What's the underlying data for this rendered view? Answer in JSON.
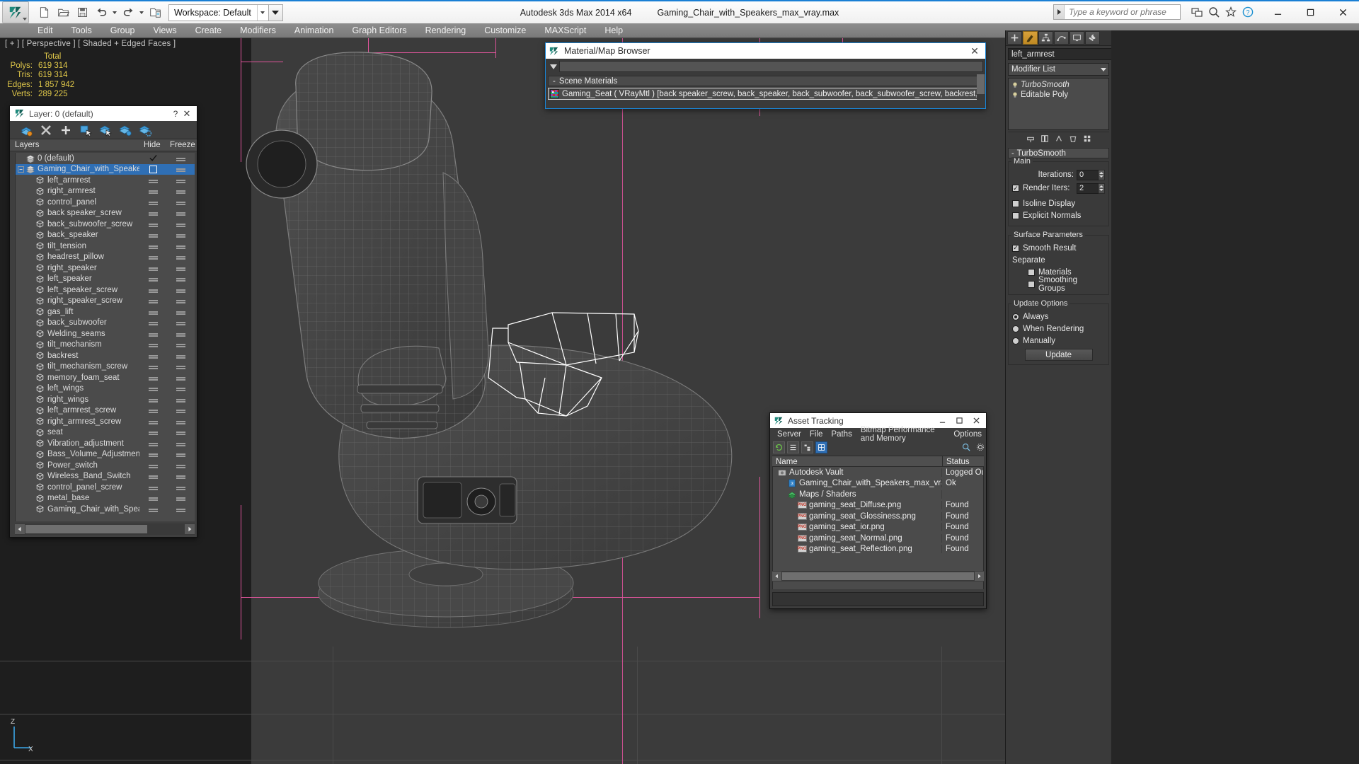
{
  "titlebar": {
    "workspace_label": "Workspace: Default",
    "app_title": "Autodesk 3ds Max  2014 x64",
    "file_title": "Gaming_Chair_with_Speakers_max_vray.max",
    "search_placeholder": "Type a keyword or phrase",
    "quick_access": [
      "new-file-icon",
      "open-file-icon",
      "save-file-icon",
      "undo-icon",
      "redo-icon",
      "set-project-folder-icon"
    ],
    "window_buttons": [
      "minimize",
      "maximize",
      "close"
    ]
  },
  "menubar": {
    "items": [
      "Edit",
      "Tools",
      "Group",
      "Views",
      "Create",
      "Modifiers",
      "Animation",
      "Graph Editors",
      "Rendering",
      "Customize",
      "MAXScript",
      "Help"
    ]
  },
  "viewport": {
    "label": "[ + ] [ Perspective ] [ Shaded + Edged Faces ]",
    "stats_header": "Total",
    "stats": [
      {
        "label": "Polys:",
        "value": "619 314"
      },
      {
        "label": "Tris:",
        "value": "619 314"
      },
      {
        "label": "Edges:",
        "value": "1 857 942"
      },
      {
        "label": "Verts:",
        "value": "289 225"
      }
    ],
    "axis": {
      "z": "Z",
      "x": "X"
    }
  },
  "layer_dialog": {
    "title": "Layer: 0 (default)",
    "help_glyph": "?",
    "close_glyph": "✕",
    "toolbar_icons": [
      "create-new-layer-icon",
      "delete-layer-icon",
      "add-selection-to-layer-icon",
      "select-objects-in-layer-icon",
      "highlight-selected-objects-icon",
      "add-to-new-layer-icon",
      "layer-properties-icon"
    ],
    "columns": {
      "name": "Layers",
      "hide": "Hide",
      "freeze": "Freeze"
    },
    "rows": [
      {
        "name": "0 (default)",
        "level": 0,
        "type": "layer",
        "hide": "check",
        "freeze": "none",
        "selected": false,
        "expander": false
      },
      {
        "name": "Gaming_Chair_with_Speakers",
        "level": 0,
        "type": "layer",
        "hide": "box",
        "freeze": "dash",
        "selected": true,
        "expander": true
      },
      {
        "name": "left_armrest",
        "level": 1,
        "type": "object",
        "hide": "dash",
        "freeze": "dash",
        "selected": false,
        "expander": false
      },
      {
        "name": "right_armrest",
        "level": 1,
        "type": "object",
        "hide": "dash",
        "freeze": "dash",
        "selected": false,
        "expander": false
      },
      {
        "name": "control_panel",
        "level": 1,
        "type": "object",
        "hide": "dash",
        "freeze": "dash",
        "selected": false,
        "expander": false
      },
      {
        "name": "back speaker_screw",
        "level": 1,
        "type": "object",
        "hide": "dash",
        "freeze": "dash",
        "selected": false,
        "expander": false
      },
      {
        "name": "back_subwoofer_screw",
        "level": 1,
        "type": "object",
        "hide": "dash",
        "freeze": "dash",
        "selected": false,
        "expander": false
      },
      {
        "name": "back_speaker",
        "level": 1,
        "type": "object",
        "hide": "dash",
        "freeze": "dash",
        "selected": false,
        "expander": false
      },
      {
        "name": "tilt_tension",
        "level": 1,
        "type": "object",
        "hide": "dash",
        "freeze": "dash",
        "selected": false,
        "expander": false
      },
      {
        "name": "headrest_pillow",
        "level": 1,
        "type": "object",
        "hide": "dash",
        "freeze": "dash",
        "selected": false,
        "expander": false
      },
      {
        "name": "right_speaker",
        "level": 1,
        "type": "object",
        "hide": "dash",
        "freeze": "dash",
        "selected": false,
        "expander": false
      },
      {
        "name": "left_speaker",
        "level": 1,
        "type": "object",
        "hide": "dash",
        "freeze": "dash",
        "selected": false,
        "expander": false
      },
      {
        "name": "left_speaker_screw",
        "level": 1,
        "type": "object",
        "hide": "dash",
        "freeze": "dash",
        "selected": false,
        "expander": false
      },
      {
        "name": "right_speaker_screw",
        "level": 1,
        "type": "object",
        "hide": "dash",
        "freeze": "dash",
        "selected": false,
        "expander": false
      },
      {
        "name": "gas_lift",
        "level": 1,
        "type": "object",
        "hide": "dash",
        "freeze": "dash",
        "selected": false,
        "expander": false
      },
      {
        "name": "back_subwoofer",
        "level": 1,
        "type": "object",
        "hide": "dash",
        "freeze": "dash",
        "selected": false,
        "expander": false
      },
      {
        "name": "Welding_seams",
        "level": 1,
        "type": "object",
        "hide": "dash",
        "freeze": "dash",
        "selected": false,
        "expander": false
      },
      {
        "name": "tilt_mechanism",
        "level": 1,
        "type": "object",
        "hide": "dash",
        "freeze": "dash",
        "selected": false,
        "expander": false
      },
      {
        "name": "backrest",
        "level": 1,
        "type": "object",
        "hide": "dash",
        "freeze": "dash",
        "selected": false,
        "expander": false
      },
      {
        "name": "tilt_mechanism_screw",
        "level": 1,
        "type": "object",
        "hide": "dash",
        "freeze": "dash",
        "selected": false,
        "expander": false
      },
      {
        "name": "memory_foam_seat",
        "level": 1,
        "type": "object",
        "hide": "dash",
        "freeze": "dash",
        "selected": false,
        "expander": false
      },
      {
        "name": "left_wings",
        "level": 1,
        "type": "object",
        "hide": "dash",
        "freeze": "dash",
        "selected": false,
        "expander": false
      },
      {
        "name": "right_wings",
        "level": 1,
        "type": "object",
        "hide": "dash",
        "freeze": "dash",
        "selected": false,
        "expander": false
      },
      {
        "name": "left_armrest_screw",
        "level": 1,
        "type": "object",
        "hide": "dash",
        "freeze": "dash",
        "selected": false,
        "expander": false
      },
      {
        "name": "right_armrest_screw",
        "level": 1,
        "type": "object",
        "hide": "dash",
        "freeze": "dash",
        "selected": false,
        "expander": false
      },
      {
        "name": "seat",
        "level": 1,
        "type": "object",
        "hide": "dash",
        "freeze": "dash",
        "selected": false,
        "expander": false
      },
      {
        "name": "Vibration_adjustment",
        "level": 1,
        "type": "object",
        "hide": "dash",
        "freeze": "dash",
        "selected": false,
        "expander": false
      },
      {
        "name": "Bass_Volume_Adjustment",
        "level": 1,
        "type": "object",
        "hide": "dash",
        "freeze": "dash",
        "selected": false,
        "expander": false
      },
      {
        "name": "Power_switch",
        "level": 1,
        "type": "object",
        "hide": "dash",
        "freeze": "dash",
        "selected": false,
        "expander": false
      },
      {
        "name": "Wireless_Band_Switch",
        "level": 1,
        "type": "object",
        "hide": "dash",
        "freeze": "dash",
        "selected": false,
        "expander": false
      },
      {
        "name": "control_panel_screw",
        "level": 1,
        "type": "object",
        "hide": "dash",
        "freeze": "dash",
        "selected": false,
        "expander": false
      },
      {
        "name": "metal_base",
        "level": 1,
        "type": "object",
        "hide": "dash",
        "freeze": "dash",
        "selected": false,
        "expander": false
      },
      {
        "name": "Gaming_Chair_with_Speakers",
        "level": 1,
        "type": "object",
        "hide": "dash",
        "freeze": "dash",
        "selected": false,
        "expander": false
      }
    ]
  },
  "material_browser": {
    "title": "Material/Map Browser",
    "close_glyph": "✕",
    "search_value": "",
    "section_label": "Scene Materials",
    "section_toggle": "-",
    "material_row": "Gaming_Seat ( VRayMtl ) [back speaker_screw, back_speaker, back_subwoofer, back_subwoofer_screw, backrest, Bass_Volume_Adjust..."
  },
  "asset_tracking": {
    "title": "Asset Tracking",
    "window_buttons": [
      "minimize",
      "maximize",
      "close"
    ],
    "menu": [
      "Server",
      "File",
      "Paths",
      "Bitmap Performance and Memory",
      "Options"
    ],
    "columns": {
      "name": "Name",
      "status": "Status"
    },
    "rows": [
      {
        "name": "Autodesk Vault",
        "status": "Logged Out",
        "level": 0,
        "icon": "vault-icon"
      },
      {
        "name": "Gaming_Chair_with_Speakers_max_vray.max",
        "status": "Ok",
        "level": 1,
        "icon": "max-file-icon"
      },
      {
        "name": "Maps / Shaders",
        "status": "",
        "level": 1,
        "icon": "maps-icon"
      },
      {
        "name": "gaming_seat_Diffuse.png",
        "status": "Found",
        "level": 2,
        "icon": "png-icon"
      },
      {
        "name": "gaming_seat_Glossiness.png",
        "status": "Found",
        "level": 2,
        "icon": "png-icon"
      },
      {
        "name": "gaming_seat_ior.png",
        "status": "Found",
        "level": 2,
        "icon": "png-icon"
      },
      {
        "name": "gaming_seat_Normal.png",
        "status": "Found",
        "level": 2,
        "icon": "png-icon"
      },
      {
        "name": "gaming_seat_Reflection.png",
        "status": "Found",
        "level": 2,
        "icon": "png-icon"
      }
    ]
  },
  "command_panel": {
    "tabs": [
      "create-tab",
      "modify-tab",
      "hierarchy-tab",
      "motion-tab",
      "display-tab",
      "utilities-tab"
    ],
    "active_tab_index": 1,
    "object_name": "left_armrest",
    "modifier_list_label": "Modifier List",
    "stack": [
      {
        "label": "TurboSmooth",
        "italic": true
      },
      {
        "label": "Editable Poly",
        "italic": false
      }
    ],
    "rollup": {
      "title": "TurboSmooth",
      "toggle": "-"
    },
    "main_group": {
      "caption": "Main",
      "iterations_label": "Iterations:",
      "iterations_value": "0",
      "render_iters_label": "Render Iters:",
      "render_iters_value": "2",
      "render_iters_checked": true,
      "isoline_display_label": "Isoline Display",
      "isoline_display_checked": false,
      "explicit_normals_label": "Explicit Normals",
      "explicit_normals_checked": false
    },
    "surface_group": {
      "caption": "Surface Parameters",
      "smooth_result_label": "Smooth Result",
      "smooth_result_checked": true,
      "separate_label": "Separate",
      "materials_label": "Materials",
      "materials_checked": false,
      "smoothing_groups_label": "Smoothing Groups",
      "smoothing_groups_checked": false
    },
    "update_group": {
      "caption": "Update Options",
      "options": [
        "Always",
        "When Rendering",
        "Manually"
      ],
      "selected": "Always",
      "update_button": "Update"
    }
  },
  "colors": {
    "accent_blue": "#1986d8",
    "selection_blue": "#2f6fb5",
    "stats_yellow": "#e0c84a",
    "viewport_bg": "#3b3b3b",
    "panel_bg": "#3a3a3a",
    "active_tab_gold": "#d8a13a",
    "pink_helper": "#e0559c"
  }
}
